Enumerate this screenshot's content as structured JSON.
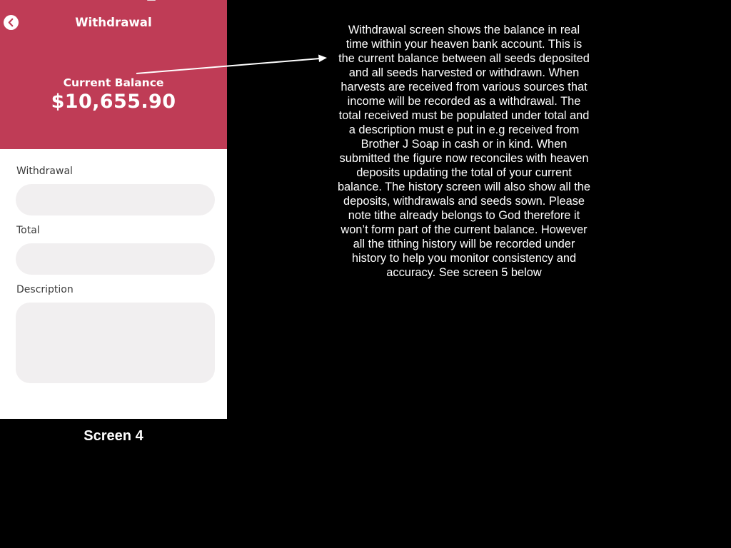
{
  "app": {
    "header": {
      "title": "Withdrawal",
      "back_icon": "chevron-left-icon",
      "color": "#bf3c56"
    },
    "balance": {
      "label": "Current Balance",
      "amount": "$10,655.90"
    },
    "form": {
      "withdrawal_label": "Withdrawal",
      "withdrawal_value": "",
      "total_label": "Total",
      "total_value": "",
      "description_label": "Description",
      "description_value": ""
    }
  },
  "caption": "Screen 4",
  "annotation": {
    "text": "Withdrawal screen shows the balance in real\ntime within your heaven bank account. This is\nthe current balance between all seeds deposited\nand all seeds harvested or withdrawn.  When\nharvests are received from various sources that\nincome will be recorded as a withdrawal. The\ntotal received must be populated under total and\na description must e put in e.g received from\nBrother J Soap in cash or in kind. When\nsubmitted the figure now reconciles with heaven\ndeposits updating the total of your current\nbalance. The history screen will also show all the\ndeposits, withdrawals and seeds sown. Please\nnote tithe already belongs to God therefore it\nwon’t form part of the current balance. However\nall the tithing history will be recorded under\nhistory to help you monitor consistency and\naccuracy. See screen 5 below"
  }
}
